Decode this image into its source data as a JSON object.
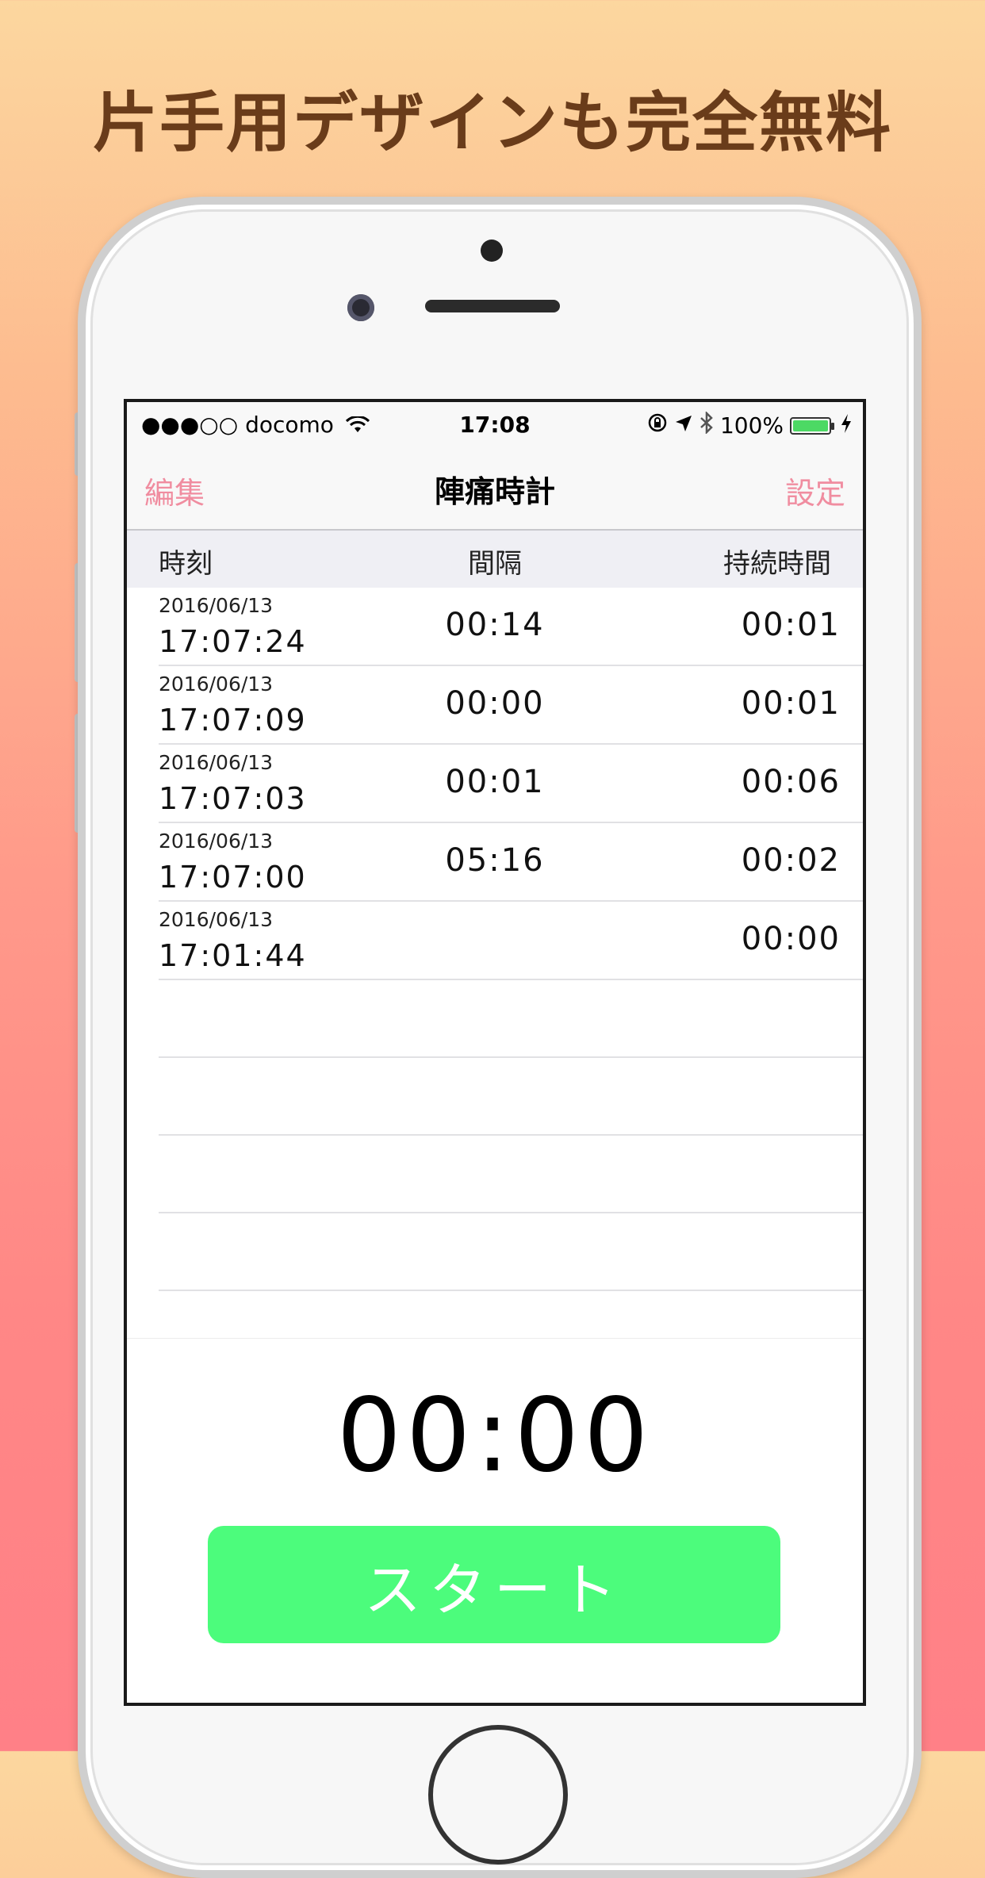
{
  "headline": "片手用デザインも完全無料",
  "status_bar": {
    "signal": "●●●○○",
    "carrier": "docomo",
    "time": "17:08",
    "battery_text": "100%",
    "battery_level": 1.0
  },
  "nav": {
    "left": "編集",
    "title": "陣痛時計",
    "right": "設定"
  },
  "columns": {
    "time": "時刻",
    "interval": "間隔",
    "duration": "持続時間"
  },
  "records": [
    {
      "date": "2016/06/13",
      "time": "17:07:24",
      "interval": "00:14",
      "duration": "00:01"
    },
    {
      "date": "2016/06/13",
      "time": "17:07:09",
      "interval": "00:00",
      "duration": "00:01"
    },
    {
      "date": "2016/06/13",
      "time": "17:07:03",
      "interval": "00:01",
      "duration": "00:06"
    },
    {
      "date": "2016/06/13",
      "time": "17:07:00",
      "interval": "05:16",
      "duration": "00:02"
    },
    {
      "date": "2016/06/13",
      "time": "17:01:44",
      "interval": "",
      "duration": "00:00"
    }
  ],
  "timer": "00:00",
  "start_button": "スタート",
  "colors": {
    "accent": "#f08da0",
    "start_button": "#4cfc7c",
    "headline": "#6a3c1a"
  }
}
